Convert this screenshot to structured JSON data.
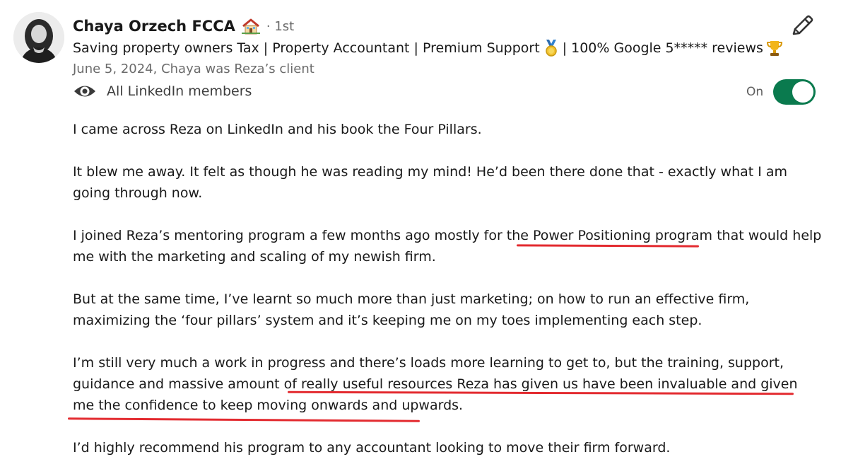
{
  "recommender": {
    "name": "Chaya Orzech FCCA",
    "name_icon": "house-emoji-icon",
    "degree": "· 1st",
    "headline_part1": "Saving property owners Tax | Property Accountant | Premium Support",
    "headline_icon1": "medal-emoji-icon",
    "headline_part2": "| 100% Google 5***** reviews",
    "headline_icon2": "trophy-emoji-icon",
    "date_relationship": "June 5, 2024, Chaya was Reza’s client"
  },
  "visibility": {
    "icon": "eye-icon",
    "label": "All LinkedIn members"
  },
  "toggle": {
    "label": "On",
    "state": "on",
    "color": "#0a7a4e"
  },
  "edit": {
    "icon": "pencil-icon"
  },
  "recommendation": {
    "p1": "I came across Reza on LinkedIn and his book the Four Pillars.",
    "p2": "It blew me away. It felt as though he was reading my mind! He’d been there done that - exactly what I am going through now.",
    "p3_a": "I joined Reza’s mentoring program a few months ago mostly for the ",
    "p3_hl": "Power Positioning program",
    "p3_b": " that would help me with the marketing and scaling of my newish firm.",
    "p4": "But at the same time, I’ve learnt so much more than just marketing; on how to run an effective firm, maximizing the ‘four pillars’ system and it’s keeping me on my toes implementing each step.",
    "p5_a": "I’m still very much a work in progress and there’s loads more learning to get to, but the training, support, guidance and massive amount of ",
    "p5_hl": "really useful resources Reza has given us have been invaluable and given me the confidence to keep moving onwards and upwards.",
    "p6": "I’d highly recommend his program to any accountant looking to move their firm forward."
  },
  "annotation_color": "#e32b30"
}
